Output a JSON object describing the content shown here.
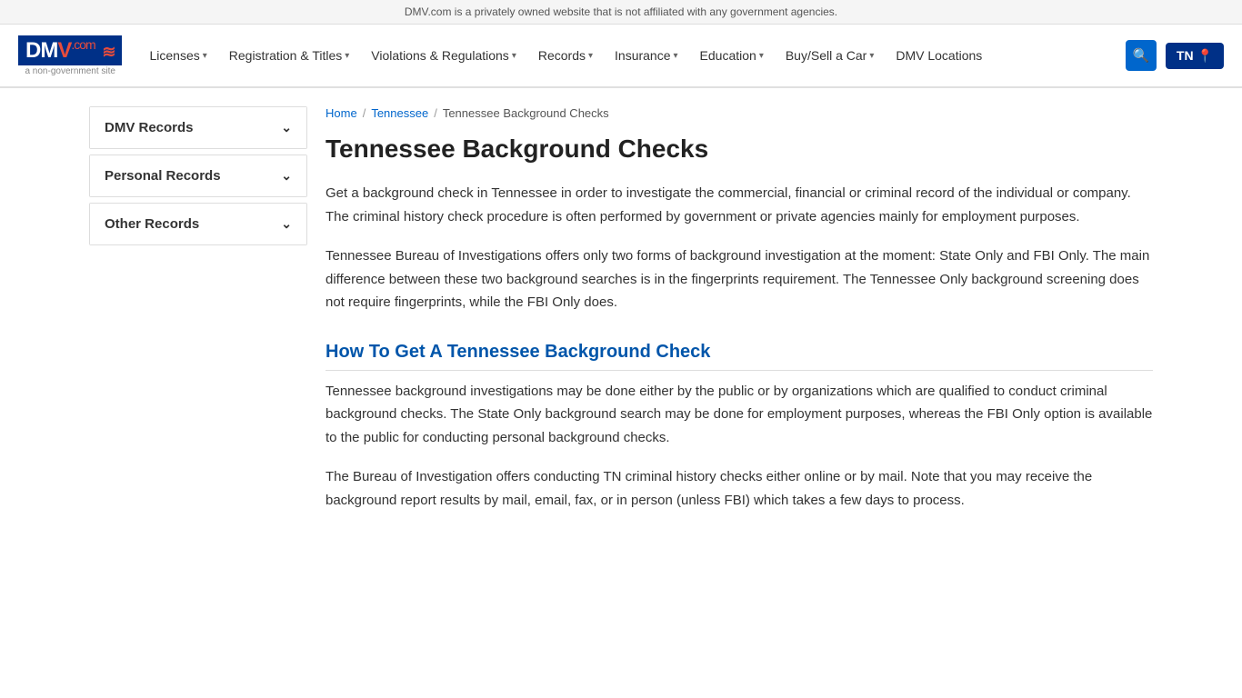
{
  "banner": {
    "text": "DMV.com is a privately owned website that is not affiliated with any government agencies."
  },
  "logo": {
    "name": "DMV",
    "suffix": ".com",
    "subtitle": "a non-government site"
  },
  "nav": {
    "items": [
      {
        "label": "Licenses",
        "hasDropdown": true
      },
      {
        "label": "Registration & Titles",
        "hasDropdown": true
      },
      {
        "label": "Violations & Regulations",
        "hasDropdown": true
      },
      {
        "label": "Records",
        "hasDropdown": true
      },
      {
        "label": "Insurance",
        "hasDropdown": true
      },
      {
        "label": "Education",
        "hasDropdown": true
      },
      {
        "label": "Buy/Sell a Car",
        "hasDropdown": true
      },
      {
        "label": "DMV Locations",
        "hasDropdown": false
      }
    ],
    "state_label": "TN"
  },
  "sidebar": {
    "items": [
      {
        "label": "DMV Records"
      },
      {
        "label": "Personal Records"
      },
      {
        "label": "Other Records"
      }
    ]
  },
  "breadcrumb": {
    "home": "Home",
    "state": "Tennessee",
    "current": "Tennessee Background Checks"
  },
  "content": {
    "title": "Tennessee Background Checks",
    "paragraphs": [
      "Get a background check in Tennessee in order to investigate the commercial, financial or criminal record of the individual or company. The criminal history check procedure is often performed by government or private agencies mainly for employment purposes.",
      "Tennessee Bureau of Investigations offers only two forms of background investigation at the moment: State Only and FBI Only. The main difference between these two background searches is in the fingerprints requirement. The Tennessee Only background screening does not require fingerprints, while the FBI Only does."
    ],
    "section_heading": "How To Get A Tennessee Background Check",
    "section_paragraphs": [
      "Tennessee background investigations may be done either by the public or by organizations which are qualified to conduct criminal background checks. The State Only background search may be done for employment purposes, whereas the FBI Only option is available to the public for conducting personal background checks.",
      "The Bureau of Investigation offers conducting TN criminal history checks either online or by mail. Note that you may receive the background report results by mail, email, fax, or in person (unless FBI) which takes a few days to process."
    ]
  }
}
